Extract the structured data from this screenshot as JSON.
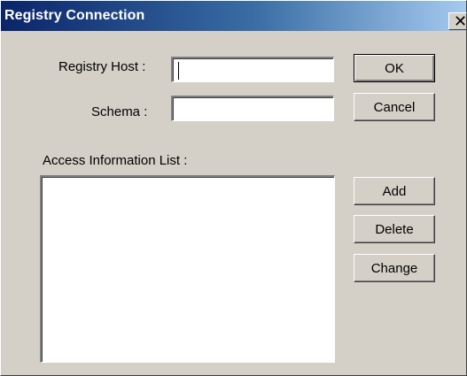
{
  "window": {
    "title": "Registry Connection",
    "close_glyph": "✕"
  },
  "form": {
    "registry_host_label": "Registry Host :",
    "registry_host_value": "",
    "schema_label": "Schema :",
    "schema_value": ""
  },
  "access_list": {
    "label": "Access Information List :",
    "items": []
  },
  "buttons": {
    "ok": "OK",
    "cancel": "Cancel",
    "add": "Add",
    "delete": "Delete",
    "change": "Change"
  },
  "colors": {
    "dialog_face": "#d4d0c8",
    "title_gradient_start": "#0a246a",
    "title_gradient_end": "#a6caf0"
  }
}
